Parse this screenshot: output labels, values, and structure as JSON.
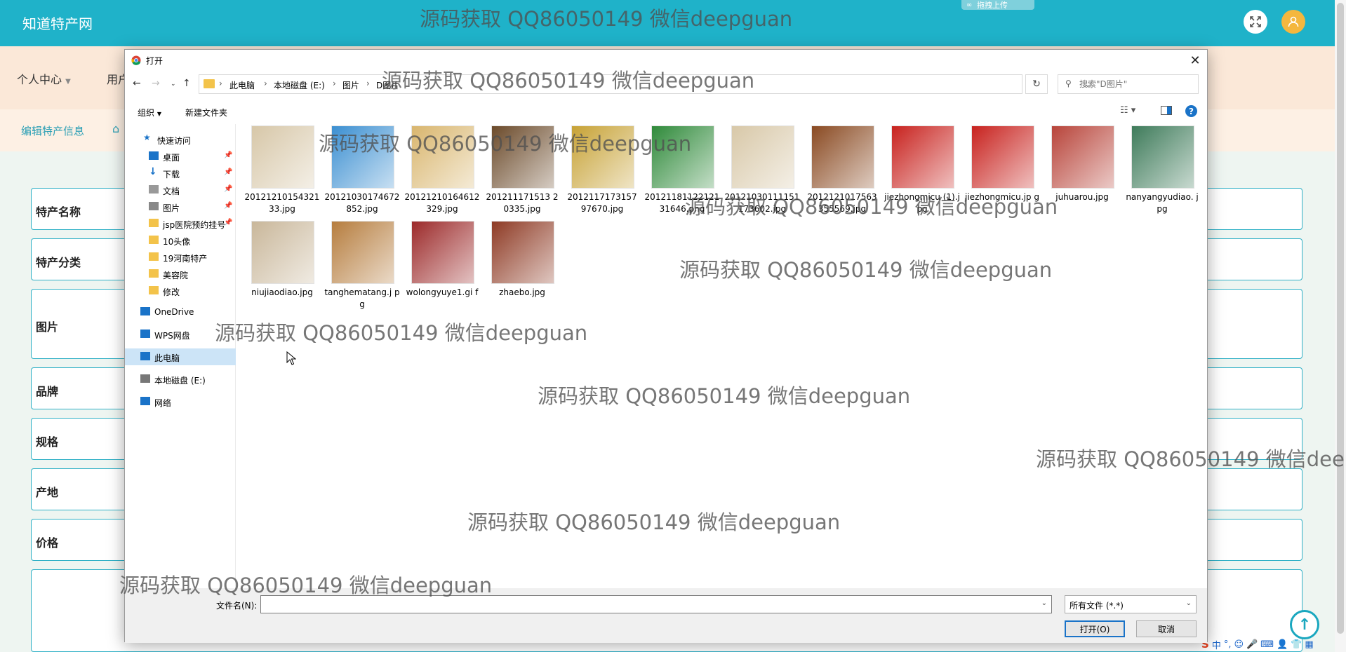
{
  "app": {
    "brand": "知道特产网",
    "upload_tag": "拖拽上传"
  },
  "nav": {
    "items": [
      "个人中心",
      "用户"
    ]
  },
  "breadcrumb": {
    "item": "编辑特产信息",
    "home_icon": "home-icon"
  },
  "form": {
    "labels": [
      "特产名称",
      "特产分类",
      "图片",
      "品牌",
      "规格",
      "产地",
      "价格"
    ]
  },
  "dialog": {
    "title": "打开",
    "path": [
      "此电脑",
      "本地磁盘 (E:)",
      "图片",
      "D图片"
    ],
    "search_placeholder": "搜索\"D图片\"",
    "organize": "组织",
    "new_folder": "新建文件夹",
    "nav_pane": [
      {
        "label": "快速访问",
        "icon": "star-icon"
      },
      {
        "label": "桌面",
        "icon": "desktop-icon",
        "pinned": true
      },
      {
        "label": "下载",
        "icon": "download-icon",
        "pinned": true
      },
      {
        "label": "文档",
        "icon": "document-icon",
        "pinned": true
      },
      {
        "label": "图片",
        "icon": "pictures-icon",
        "pinned": true
      },
      {
        "label": "jsp医院预约挂号",
        "icon": "folder-icon",
        "pinned": true
      },
      {
        "label": "10头像",
        "icon": "folder-icon"
      },
      {
        "label": "19河南特产",
        "icon": "folder-icon"
      },
      {
        "label": "美容院",
        "icon": "folder-icon"
      },
      {
        "label": "修改",
        "icon": "folder-icon"
      },
      {
        "label": "OneDrive",
        "icon": "cloud-icon"
      },
      {
        "label": "WPS网盘",
        "icon": "cloud-icon"
      },
      {
        "label": "此电脑",
        "icon": "computer-icon",
        "selected": true
      },
      {
        "label": "本地磁盘 (E:)",
        "icon": "drive-icon"
      },
      {
        "label": "网络",
        "icon": "network-icon"
      }
    ],
    "files": [
      {
        "name": "2012121015432133.jpg",
        "color": "#d7c7a8"
      },
      {
        "name": "20121030174672852.jpg",
        "color": "#3b8fd1"
      },
      {
        "name": "20121210164612329.jpg",
        "color": "#d9b66e"
      },
      {
        "name": "201211171513 20335.jpg",
        "color": "#6b4a2a"
      },
      {
        "name": "2012117173157 97670.jpg",
        "color": "#c7a235"
      },
      {
        "name": "20121181122121 31646.png",
        "color": "#2f8a3a"
      },
      {
        "name": "20121030111151 173602.jpg",
        "color": "#d8c8a8"
      },
      {
        "name": "2012121017563 355569.jpg",
        "color": "#8a4a22"
      },
      {
        "name": "jiezhongmicu (1).jpg",
        "color": "#c8221e"
      },
      {
        "name": "jiezhongmicu.jp g",
        "color": "#c8221e"
      },
      {
        "name": "juhuarou.jpg",
        "color": "#b8443a"
      },
      {
        "name": "nanyangyudiao. jpg",
        "color": "#3e7b5a"
      },
      {
        "name": "niujiaodiao.jpg",
        "color": "#c9b79a"
      },
      {
        "name": "tanghematang.j pg",
        "color": "#b67d3e"
      },
      {
        "name": "wolongyuye1.gi f",
        "color": "#9c2a2a"
      },
      {
        "name": "zhaebo.jpg",
        "color": "#8e3a24"
      }
    ],
    "filename_label": "文件名(N):",
    "filename_value": "",
    "file_type": "所有文件 (*.*)",
    "open_button": "打开(O)",
    "cancel_button": "取消"
  },
  "watermarks": [
    "源码获取 QQ86050149 微信deepguan",
    "源码获取 QQ86050149 微信deepguan",
    "源码获取 QQ86050149 微信deepguan",
    "源码获取 QQ86050149 微信deepguan",
    "源码获取 QQ86050149 微信deepguan",
    "源码获取 QQ86050149 微信deepguan",
    "源码获取 QQ86050149 微信deepguan",
    "源码获取 QQ86050149 微信deepguan",
    "源码获取 QQ86050149 微信deepguan",
    "源码获取 QQ86050149 微信dee"
  ],
  "ime": [
    "中",
    "°,",
    "☺",
    "🎤",
    "⌨",
    "👤",
    "👕",
    "▦"
  ]
}
